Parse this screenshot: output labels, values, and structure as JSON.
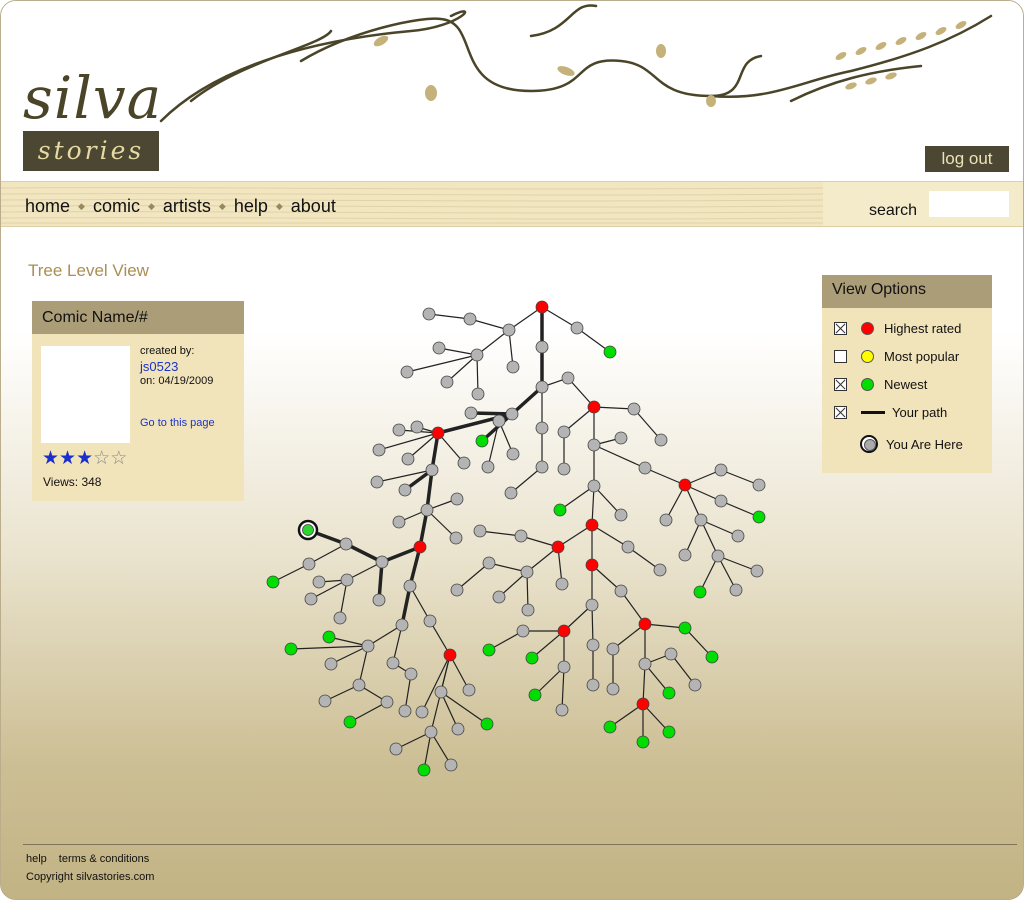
{
  "header": {
    "logo_top": "silva",
    "logo_bottom": "stories",
    "logout_label": "log out"
  },
  "nav": {
    "items": [
      {
        "label": "home"
      },
      {
        "label": "comic"
      },
      {
        "label": "artists"
      },
      {
        "label": "help"
      },
      {
        "label": "about"
      }
    ],
    "search_label": "search",
    "search_value": ""
  },
  "page_title": "Tree Level View",
  "comic": {
    "name": "Comic Name/#",
    "created_by_label": "created by:",
    "creator": "js0523",
    "date_line": "on: 04/19/2009",
    "goto_label": "Go to this page",
    "rating": 3,
    "rating_max": 5,
    "views_line": "Views: 348"
  },
  "view_options": {
    "title": "View Options",
    "items": [
      {
        "label": "Highest rated",
        "checked": true,
        "color": "#ff0000"
      },
      {
        "label": "Most popular",
        "checked": false,
        "color": "#ffff00"
      },
      {
        "label": "Newest",
        "checked": true,
        "color": "#00dd00"
      },
      {
        "label": "Your path",
        "checked": true
      },
      {
        "label": "You Are Here"
      }
    ]
  },
  "footer": {
    "links": [
      {
        "label": "help"
      },
      {
        "label": "terms & conditions"
      }
    ],
    "copyright": "Copyright silvastories.com"
  },
  "colors": {
    "node_default": "#b4b4b4",
    "node_highest": "#ff0000",
    "node_newest": "#00dd00",
    "accent": "#a88f52",
    "panel_bg": "#f2e4ba",
    "panel_head": "#ab9d77"
  }
}
